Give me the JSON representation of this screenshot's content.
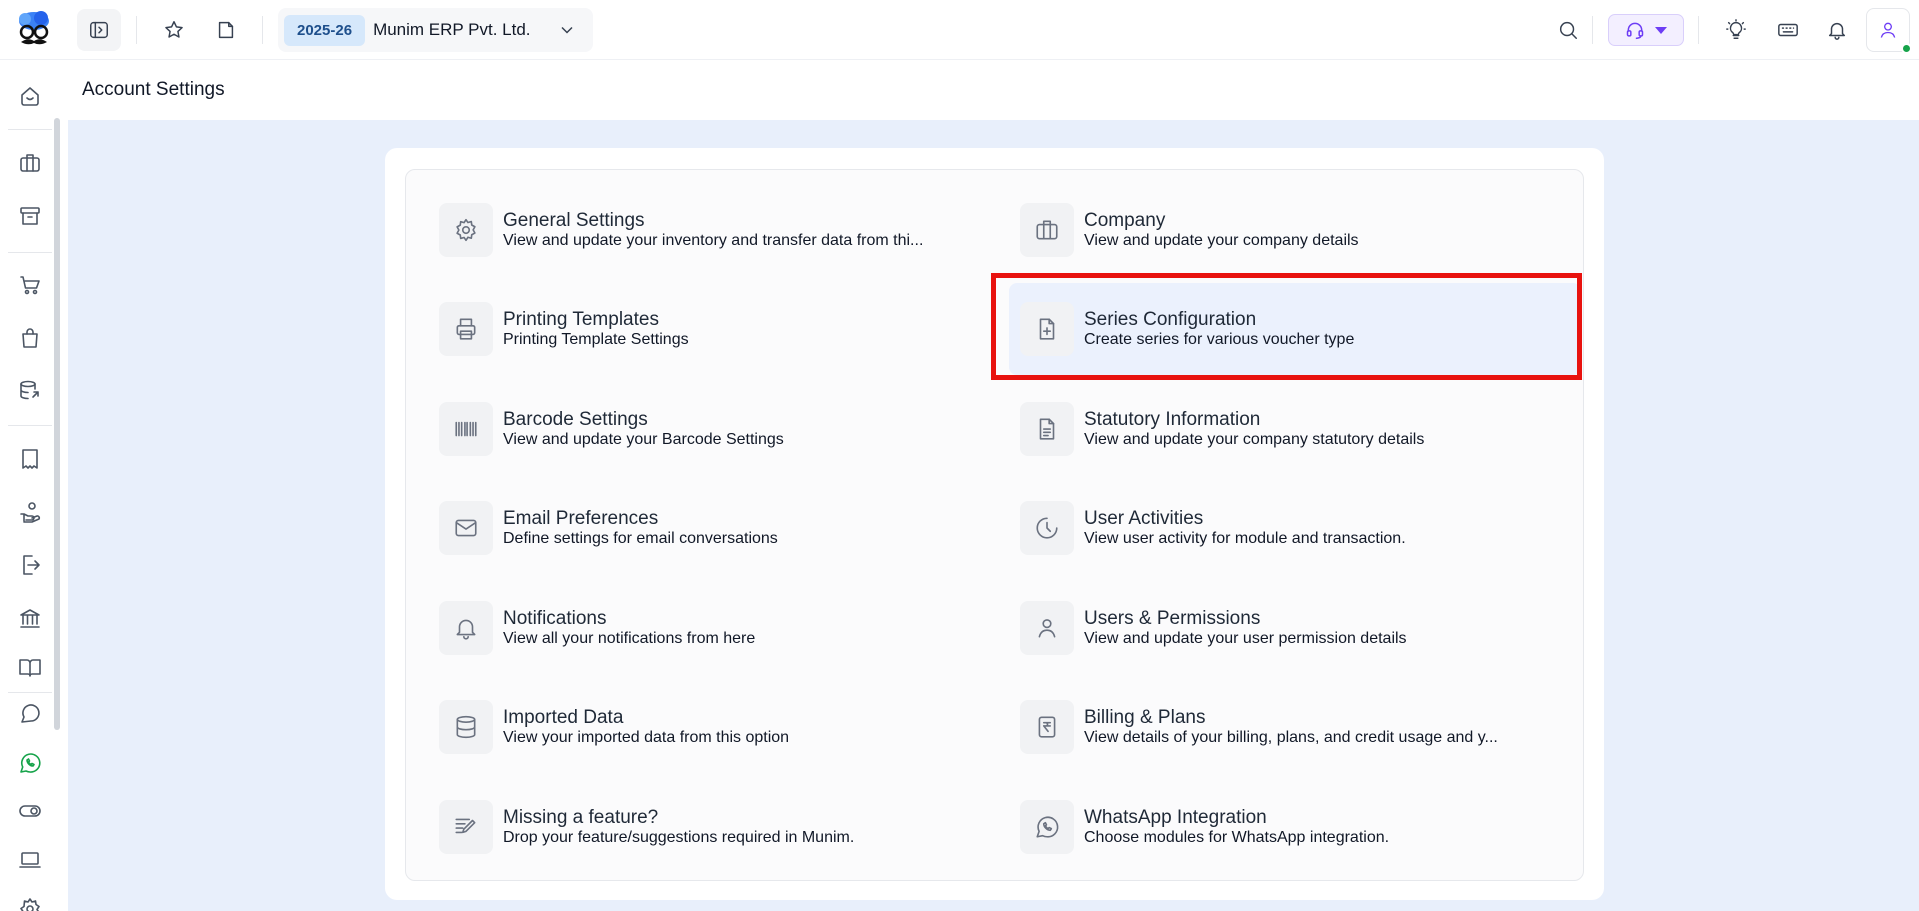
{
  "topbar": {
    "financial_year": "2025-26",
    "company_name": "Munim ERP Pvt. Ltd."
  },
  "page": {
    "title": "Account Settings"
  },
  "settings": [
    {
      "title": "General Settings",
      "description": "View and update your inventory and transfer data from thi...",
      "icon": "gear-icon"
    },
    {
      "title": "Company",
      "description": "View and update your company details",
      "icon": "briefcase-icon"
    },
    {
      "title": "Printing Templates",
      "description": "Printing Template Settings",
      "icon": "printer-icon"
    },
    {
      "title": "Series Configuration",
      "description": "Create series for various voucher type",
      "icon": "file-plus-icon"
    },
    {
      "title": "Barcode Settings",
      "description": "View and update your Barcode Settings",
      "icon": "barcode-icon"
    },
    {
      "title": "Statutory Information",
      "description": "View and update your company statutory details",
      "icon": "document-icon"
    },
    {
      "title": "Email Preferences",
      "description": "Define settings for email conversations",
      "icon": "mail-icon"
    },
    {
      "title": "User Activities",
      "description": "View user activity for module and transaction.",
      "icon": "clock-icon"
    },
    {
      "title": "Notifications",
      "description": "View all your notifications from here",
      "icon": "bell-icon"
    },
    {
      "title": "Users & Permissions",
      "description": "View and update your user permission details",
      "icon": "user-icon"
    },
    {
      "title": "Imported Data",
      "description": "View your imported data from this option",
      "icon": "database-icon"
    },
    {
      "title": "Billing & Plans",
      "description": "View details of your billing, plans, and credit usage and y...",
      "icon": "rupee-receipt-icon"
    },
    {
      "title": "Missing a feature?",
      "description": "Drop your feature/suggestions required in Munim.",
      "icon": "edit-note-icon"
    },
    {
      "title": "WhatsApp Integration",
      "description": "Choose modules for WhatsApp integration.",
      "icon": "whatsapp-icon"
    }
  ],
  "colors": {
    "accent": "#6d3df5",
    "highlight": "#e8120f",
    "active_row": "#ebf1fd",
    "background": "#e8effb"
  }
}
